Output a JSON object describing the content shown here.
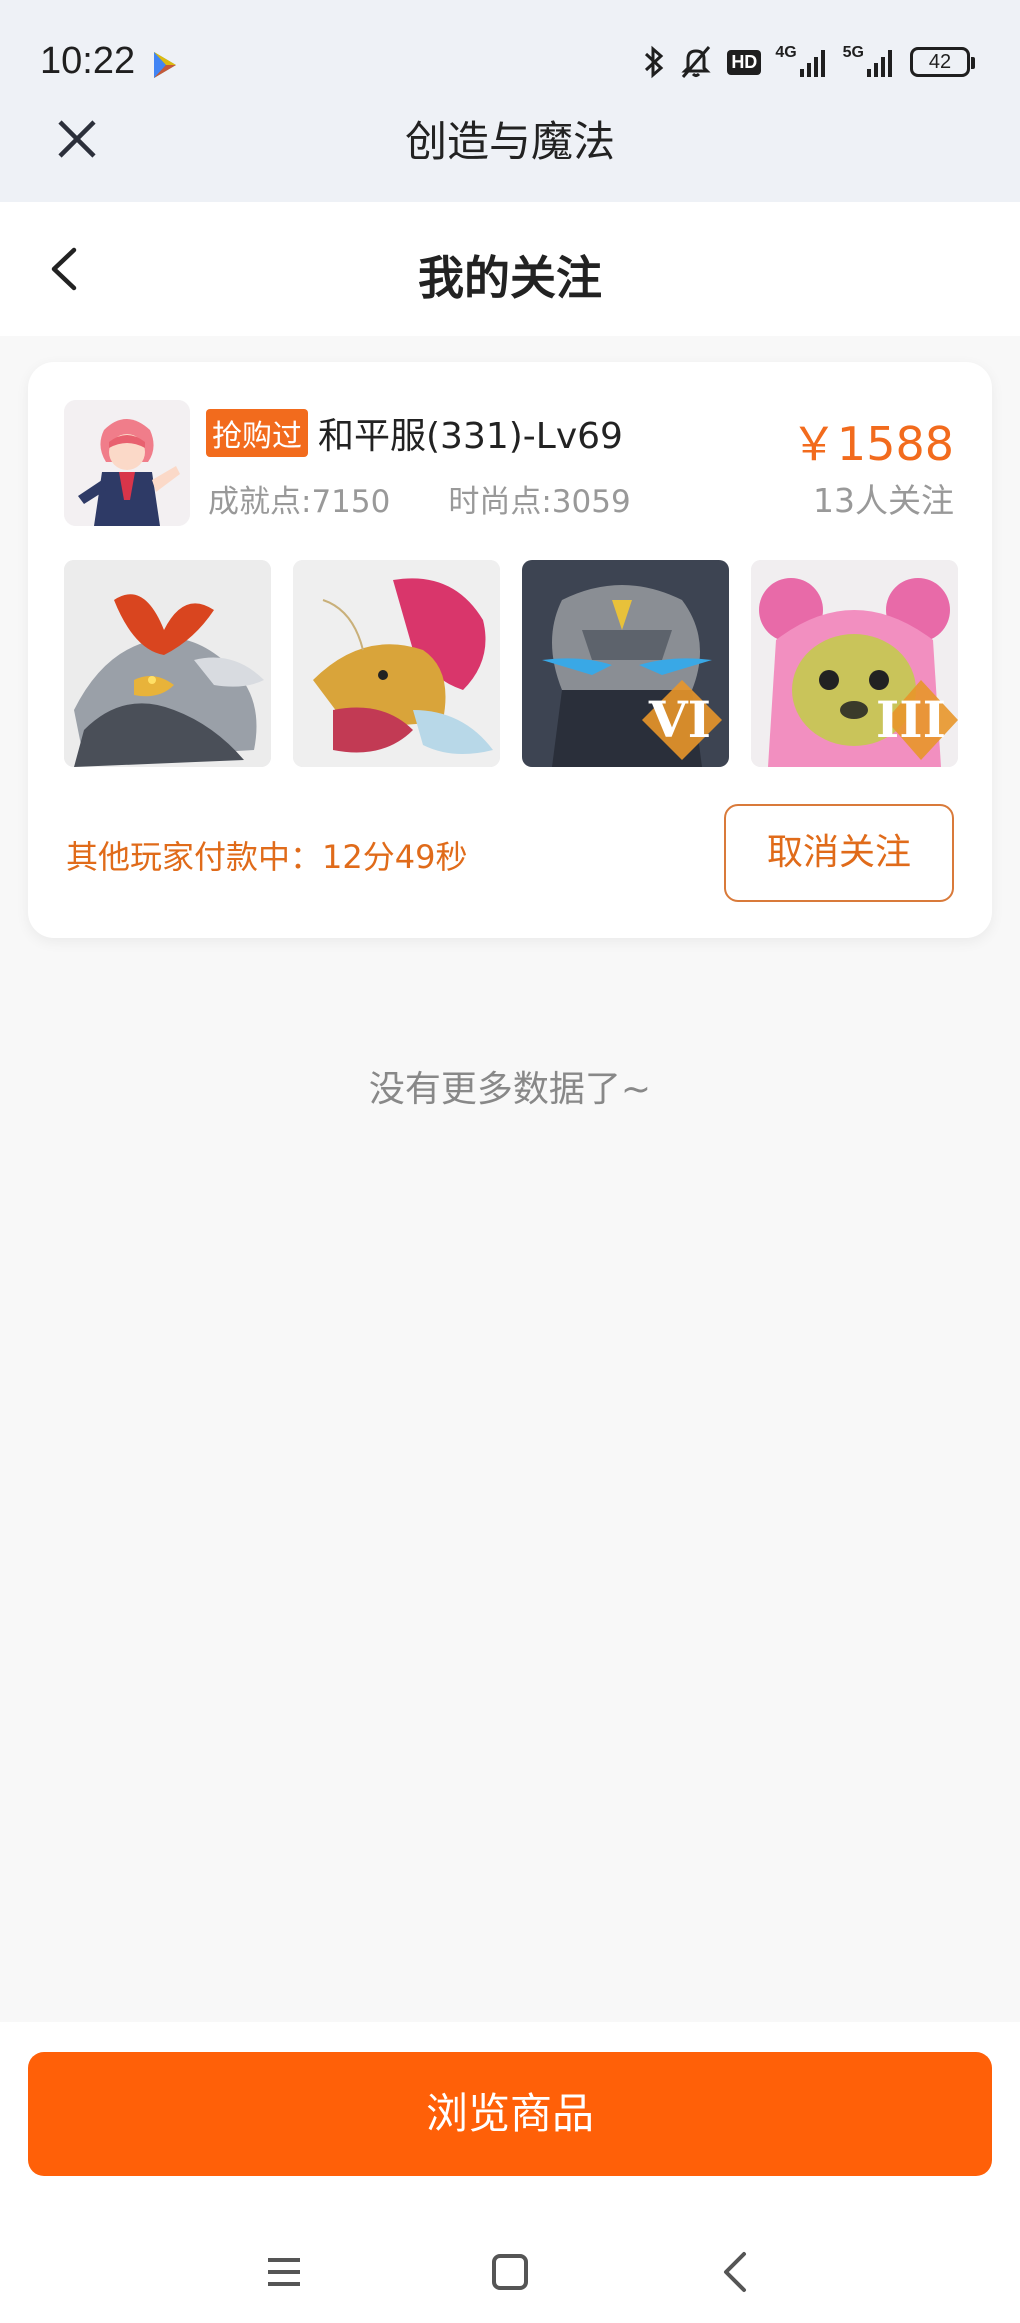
{
  "status_bar": {
    "time": "10:22",
    "hd_label": "HD",
    "net1": "4G",
    "net2": "5G",
    "battery": "42"
  },
  "mini_program": {
    "title": "创造与魔法"
  },
  "page": {
    "title": "我的关注"
  },
  "card": {
    "tag": "抢购过",
    "name": "和平服(331)-Lv69",
    "achievement": "成就点:7150",
    "fashion": "时尚点:3059",
    "price": "￥1588",
    "followers": "13人关注",
    "thumbnails": [
      {
        "name": "silver-dragon-mount",
        "badge": ""
      },
      {
        "name": "colorful-dragon-mount",
        "badge": ""
      },
      {
        "name": "stone-golem-pet",
        "badge": "VI"
      },
      {
        "name": "pink-bear-pet",
        "badge": "III"
      }
    ],
    "pay_status": "其他玩家付款中：12分49秒",
    "unfollow_label": "取消关注"
  },
  "list_end_text": "没有更多数据了~",
  "bottom": {
    "browse_label": "浏览商品"
  },
  "colors": {
    "accent": "#ff6008",
    "price": "#f26b1d",
    "header_bg": "#eef1f6"
  },
  "icons": [
    "play-store-icon",
    "bluetooth-icon",
    "mute-bell-icon",
    "signal-icon",
    "battery-icon",
    "close-icon",
    "back-icon",
    "menu-icon",
    "home-icon",
    "nav-back-icon"
  ]
}
